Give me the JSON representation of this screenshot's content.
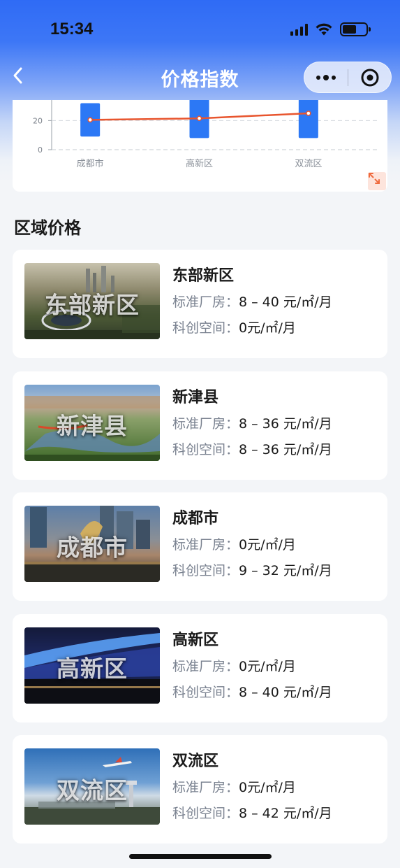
{
  "status_bar": {
    "time": "15:34"
  },
  "nav": {
    "title": "价格指数"
  },
  "chart_data": {
    "type": "bar",
    "categories": [
      "成都市",
      "高新区",
      "双流区"
    ],
    "y_ticks": [
      "0",
      "20"
    ],
    "series": [
      {
        "type": "bar",
        "ranges": [
          [
            9,
            32
          ],
          [
            8,
            40
          ],
          [
            8,
            42
          ]
        ]
      },
      {
        "type": "line",
        "values": [
          20.5,
          21.5,
          25
        ]
      }
    ],
    "ylim_visible": [
      0,
      35
    ],
    "grid": true,
    "accent_bar": "#2c78f5",
    "accent_line": "#e8552e"
  },
  "section": {
    "title": "区域价格"
  },
  "regions": [
    {
      "name": "东部新区",
      "overlay": "东部新区",
      "factory_label": "标准厂房：",
      "factory_value": "8 – 40 元/㎡/月",
      "tech_label": "科创空间：",
      "tech_value": "0元/㎡/月"
    },
    {
      "name": "新津县",
      "overlay": "新津县",
      "factory_label": "标准厂房：",
      "factory_value": "8 – 36 元/㎡/月",
      "tech_label": "科创空间：",
      "tech_value": "8 – 36 元/㎡/月"
    },
    {
      "name": "成都市",
      "overlay": "成都市",
      "factory_label": "标准厂房：",
      "factory_value": "0元/㎡/月",
      "tech_label": "科创空间：",
      "tech_value": "9 – 32 元/㎡/月"
    },
    {
      "name": "高新区",
      "overlay": "高新区",
      "factory_label": "标准厂房：",
      "factory_value": "0元/㎡/月",
      "tech_label": "科创空间：",
      "tech_value": "8 – 40 元/㎡/月"
    },
    {
      "name": "双流区",
      "overlay": "双流区",
      "factory_label": "标准厂房：",
      "factory_value": "0元/㎡/月",
      "tech_label": "科创空间：",
      "tech_value": "8 – 42 元/㎡/月"
    }
  ]
}
